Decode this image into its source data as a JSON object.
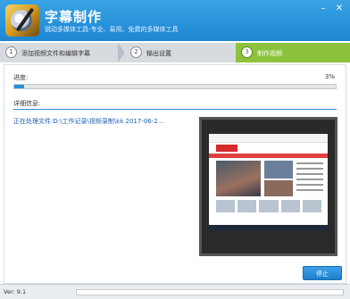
{
  "header": {
    "title": "字幕制作",
    "subtitle": "锐动多媒体工具-专业、易用、免费的多媒体工具"
  },
  "steps": [
    {
      "num": "1",
      "label": "添加视频文件和编辑字幕"
    },
    {
      "num": "2",
      "label": "输出设置"
    },
    {
      "num": "3",
      "label": "制作视频"
    }
  ],
  "main": {
    "progress_label": "进度:",
    "progress_percent": "3%",
    "progress_fraction": 0.03,
    "details_label": "详细信息:",
    "processing_text": "正在处理文件:D:\\工作记录\\视频录制\\kk 2017-06-2...",
    "stop_button": "停止"
  },
  "footer": {
    "version": "Ver: 9.1"
  },
  "colors": {
    "header": "#2a95dc",
    "active_step": "#8dc33c",
    "accent": "#2b8fd6"
  }
}
